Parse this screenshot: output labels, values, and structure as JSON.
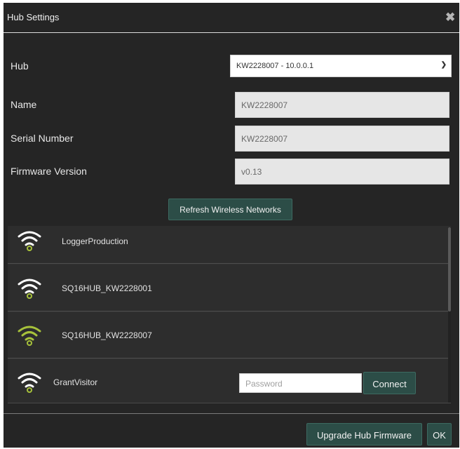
{
  "dialog": {
    "title": "Hub Settings",
    "close_icon": "close-icon"
  },
  "form": {
    "hub_label": "Hub",
    "hub_selected": "KW2228007 - 10.0.0.1",
    "name_label": "Name",
    "name_value": "KW2228007",
    "serial_label": "Serial Number",
    "serial_value": "KW2228007",
    "firmware_label": "Firmware Version",
    "firmware_value": "v0.13"
  },
  "refresh_label": "Refresh Wireless Networks",
  "networks": [
    {
      "name": "LoggerProduction",
      "icon": "wifi-icon",
      "icon_color": "#ffffff"
    },
    {
      "name": "SQ16HUB_KW2228001",
      "icon": "wifi-icon",
      "icon_color": "#ffffff"
    },
    {
      "name": "SQ16HUB_KW2228007",
      "icon": "wifi-icon",
      "icon_color": "#a7c23b"
    },
    {
      "name": "GrantVisitor",
      "icon": "wifi-icon",
      "icon_color": "#ffffff",
      "password_placeholder": "Password",
      "connect_label": "Connect"
    }
  ],
  "footer": {
    "upgrade_label": "Upgrade Hub Firmware",
    "ok_label": "OK"
  },
  "colors": {
    "dialog_bg": "#252525",
    "button_bg": "#2c4d47",
    "wifi_accent": "#a7c23b"
  }
}
